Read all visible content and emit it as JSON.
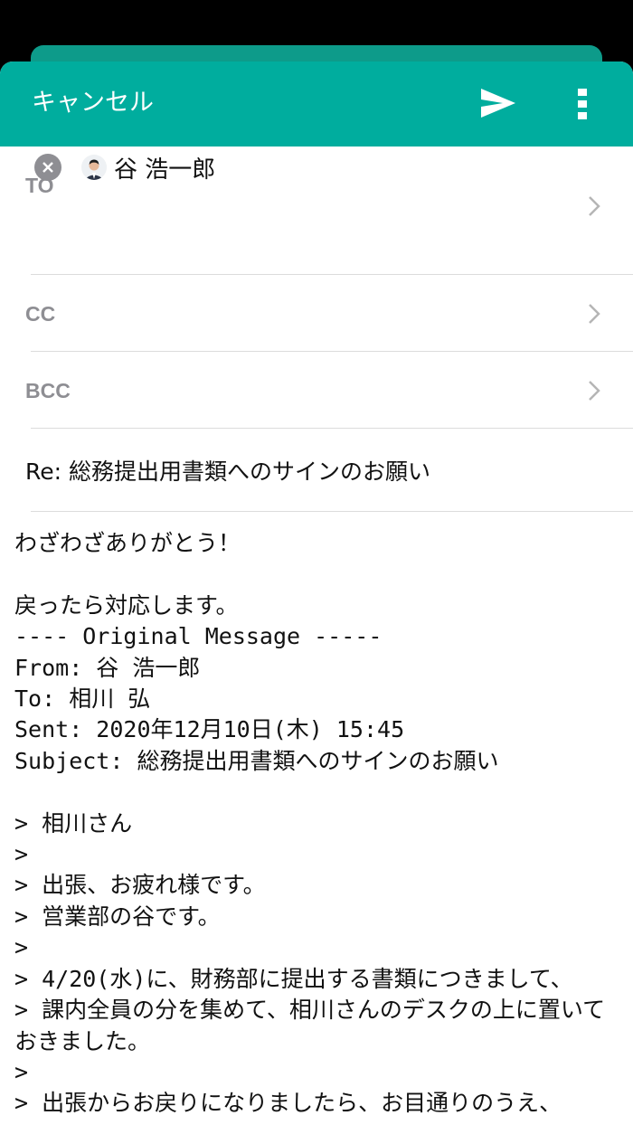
{
  "header": {
    "cancel_label": "キャンセル",
    "accent_color": "#00ad9e",
    "send_icon": "send-icon",
    "more_icon": "more-vertical-icon"
  },
  "to": {
    "label": "TO",
    "recipients": [
      {
        "name": "谷 浩一郎"
      }
    ]
  },
  "cc": {
    "label": "CC"
  },
  "bcc": {
    "label": "BCC"
  },
  "subject": {
    "value": "Re: 総務提出用書類へのサインのお願い"
  },
  "body": {
    "lines": [
      "わざわざありがとう！",
      "",
      "戻ったら対応します。",
      "---- Original Message -----",
      "From: 谷 浩一郎",
      "To: 相川 弘",
      "Sent: 2020年12月10日(木) 15:45",
      "Subject: 総務提出用書類へのサインのお願い",
      "",
      "> 相川さん",
      ">",
      "> 出張、お疲れ様です。",
      "> 営業部の谷です。",
      ">",
      "> 4/20(水)に、財務部に提出する書類につきまして、",
      "> 課内全員の分を集めて、相川さんのデスクの上に置いておきました。",
      ">",
      "> 出張からお戻りになりましたら、お目通りのうえ、"
    ]
  }
}
